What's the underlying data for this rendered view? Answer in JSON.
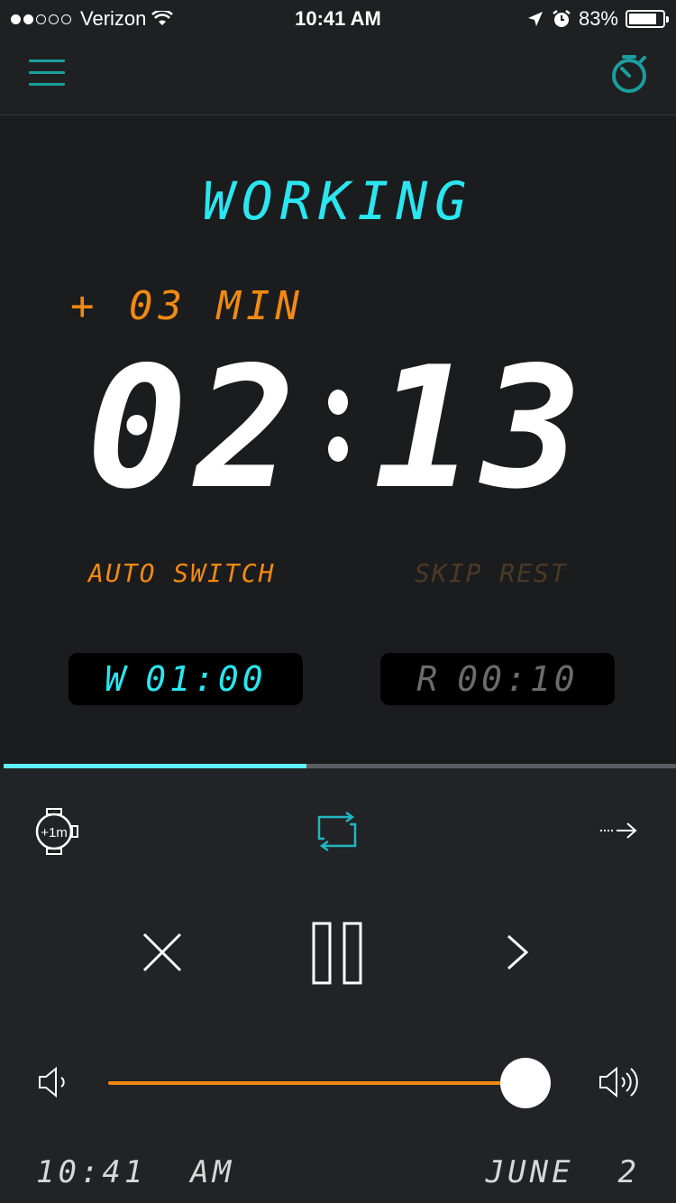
{
  "status_bar": {
    "carrier": "Verizon",
    "time": "10:41 AM",
    "battery": "83%",
    "battery_level": 0.83,
    "icons": [
      "signal-dots-icon",
      "wifi-icon",
      "location-arrow-icon",
      "alarm-icon",
      "battery-icon"
    ]
  },
  "nav": {
    "menu_icon": "hamburger-menu-icon",
    "stopwatch_icon": "stopwatch-icon"
  },
  "timer": {
    "phase": "WORKING",
    "extra": "+ 03 MIN",
    "minutes": "02",
    "seconds": "13",
    "auto_switch_label": "AUTO SWITCH",
    "skip_rest_label": "SKIP REST",
    "work_chip": {
      "prefix": "W",
      "value": "01:00"
    },
    "rest_chip": {
      "prefix": "R",
      "value": "00:10"
    },
    "progress": 0.45
  },
  "controls": {
    "add_minute_label": "+1m",
    "icons": [
      "add-minute-watch-icon",
      "loop-icon",
      "skip-arrow-icon",
      "close-icon",
      "pause-icon",
      "next-icon",
      "volume-low-icon",
      "volume-high-icon"
    ],
    "volume": 0.96
  },
  "footer": {
    "time": "10:41  AM",
    "date": "JUNE  2"
  },
  "colors": {
    "accent_cyan": "#2ae6f0",
    "accent_orange": "#f38a10",
    "teal_icon": "#1a9e9e",
    "background": "#1b1c1e"
  }
}
